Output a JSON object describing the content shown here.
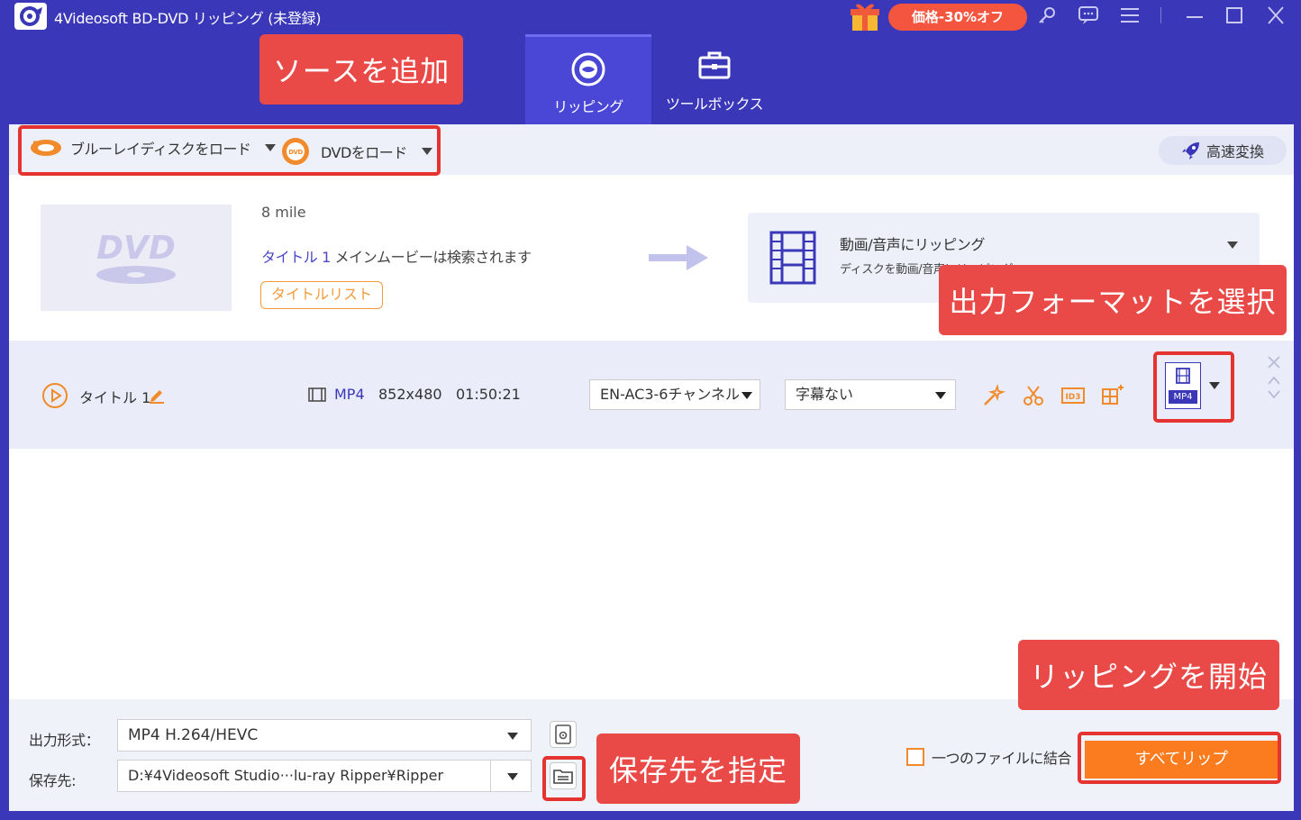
{
  "app": {
    "title": "4Videosoft BD-DVD リッピング (未登録)",
    "promo": "価格-30%オフ"
  },
  "tabs": [
    {
      "label": "リッピング",
      "active": true
    },
    {
      "label": "ツールボックス",
      "active": false
    }
  ],
  "load": {
    "bluray_label": "ブルーレイディスクをロード",
    "dvd_label": "DVDをロード",
    "speed_label": "高速変換"
  },
  "disc": {
    "name": "8 mile",
    "title_link": "タイトル 1",
    "title_desc": "メインムービーは検索されます",
    "titlelist_button": "タイトルリスト",
    "output_title": "動画/音声にリッピング",
    "output_sub": "ディスクを動画/音声にリッピング"
  },
  "title_row": {
    "name": "タイトル 1",
    "format": "MP4",
    "resolution": "852x480",
    "duration": "01:50:21",
    "audio": "EN-AC3-6チャンネル",
    "subtitle": "字幕ない",
    "format_badge": "MP4"
  },
  "bottom": {
    "format_label": "出力形式：",
    "format_value": "MP4 H.264/HEVC",
    "save_label": "保存先:",
    "save_value": "D:¥4Videosoft Studio···lu-ray Ripper¥Ripper",
    "merge_label": "一つのファイルに結合",
    "rip_all": "すべてリップ"
  },
  "callouts": {
    "add_source": "ソースを追加",
    "output_format": "出力フォーマットを選択",
    "start_rip": "リッピングを開始",
    "save_dest": "保存先を指定"
  },
  "colors": {
    "brand": "#3a37b8",
    "accent_orange": "#fa7c1e",
    "callout_red": "#ea4a47"
  }
}
